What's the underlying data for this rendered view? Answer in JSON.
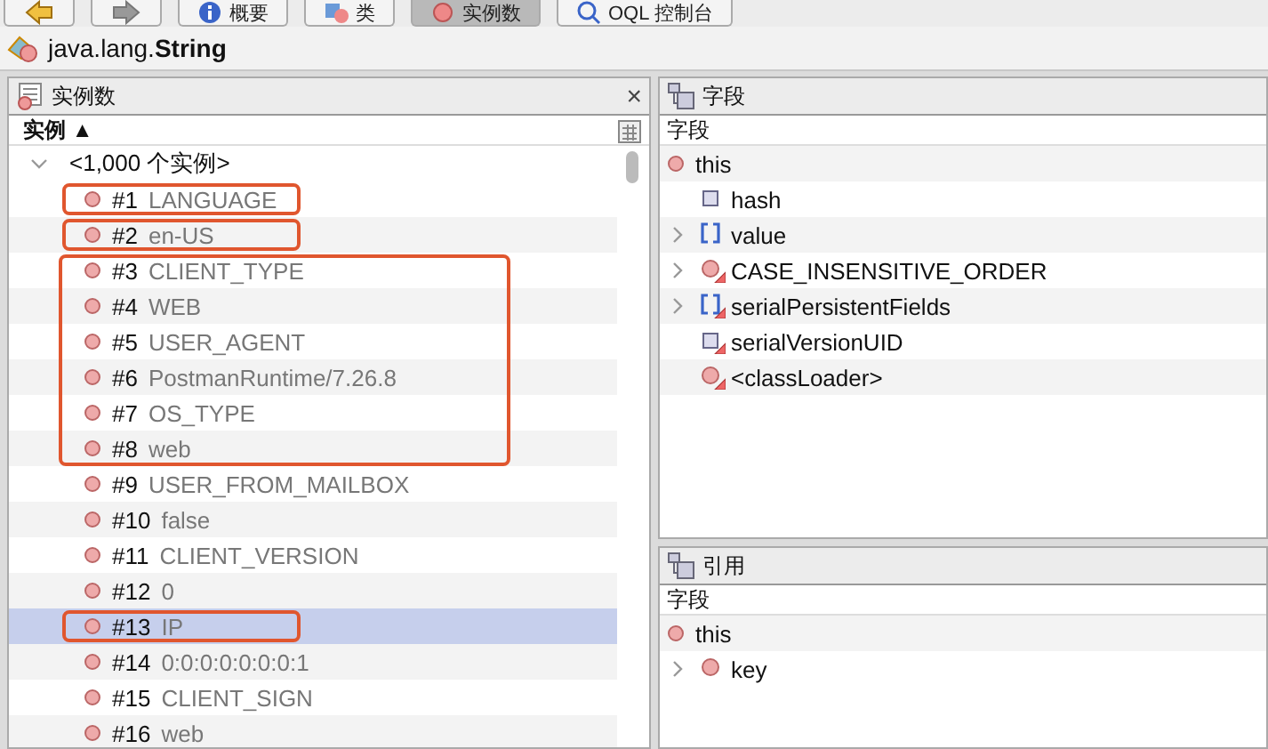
{
  "toolbar": {
    "buttons": [
      {
        "kind": "back",
        "selected": false
      },
      {
        "kind": "forward",
        "selected": false
      },
      {
        "kind": "info",
        "label": "概要",
        "selected": false
      },
      {
        "kind": "class",
        "label": "类",
        "selected": false
      },
      {
        "kind": "instances",
        "label": "实例数",
        "selected": true
      },
      {
        "kind": "query",
        "label": "OQL 控制台",
        "selected": false
      }
    ]
  },
  "class_title": "java.lang.String",
  "instances_panel": {
    "title": "实例数",
    "close": "×",
    "column": "实例 ▲",
    "group": {
      "label": "<1,000 个实例>",
      "expanded": true
    },
    "rows": [
      {
        "kind": "annotation",
        "rows": [
          {
            "number": "#1",
            "value": "LANGUAGE",
            "selected": false
          }
        ]
      },
      {
        "kind": "annotation",
        "rows": [
          {
            "number": "#2",
            "value": "en-US",
            "selected": false
          }
        ]
      },
      {
        "kind": "annotation",
        "rows": [
          {
            "number": "#3",
            "value": "CLIENT_TYPE",
            "selected": false
          },
          {
            "number": "#4",
            "value": "WEB",
            "selected": false
          },
          {
            "number": "#5",
            "value": "USER_AGENT",
            "selected": false
          },
          {
            "number": "#6",
            "value": "PostmanRuntime/7.26.8",
            "selected": false
          },
          {
            "number": "#7",
            "value": "OS_TYPE",
            "selected": false
          },
          {
            "number": "#8",
            "value": "web",
            "selected": false
          }
        ]
      },
      {
        "kind": "instance",
        "number": "#9",
        "value": "USER_FROM_MAILBOX",
        "selected": false
      },
      {
        "kind": "instance",
        "number": "#10",
        "value": "false",
        "selected": false
      },
      {
        "kind": "instance",
        "number": "#11",
        "value": "CLIENT_VERSION",
        "selected": false
      },
      {
        "kind": "instance",
        "number": "#12",
        "value": "0",
        "selected": false
      },
      {
        "kind": "annotation",
        "rows": [
          {
            "number": "#13",
            "value": "IP",
            "selected": true
          }
        ]
      },
      {
        "kind": "instance",
        "number": "#14",
        "value": "0:0:0:0:0:0:0:1",
        "selected": false
      },
      {
        "kind": "instance",
        "number": "#15",
        "value": "CLIENT_SIGN",
        "selected": false
      },
      {
        "kind": "instance",
        "number": "#16",
        "value": "web",
        "selected": false
      }
    ]
  },
  "fields_panel": {
    "title": "字段",
    "column": "字段",
    "root": "this",
    "items": [
      {
        "kind": "primitive",
        "name": "hash",
        "expandable": false,
        "static": false
      },
      {
        "kind": "array",
        "name": "value",
        "expandable": true,
        "static": false
      },
      {
        "kind": "object",
        "name": "CASE_INSENSITIVE_ORDER",
        "expandable": true,
        "static": true
      },
      {
        "kind": "array",
        "name": "serialPersistentFields",
        "expandable": true,
        "static": true
      },
      {
        "kind": "primitive",
        "name": "serialVersionUID",
        "expandable": false,
        "static": true
      },
      {
        "kind": "object",
        "name": "<classLoader>",
        "expandable": false,
        "static": true
      }
    ]
  },
  "references_panel": {
    "title": "引用",
    "column": "字段",
    "root": "this",
    "items": [
      {
        "kind": "object",
        "name": "key",
        "expandable": true,
        "static": false
      }
    ]
  }
}
